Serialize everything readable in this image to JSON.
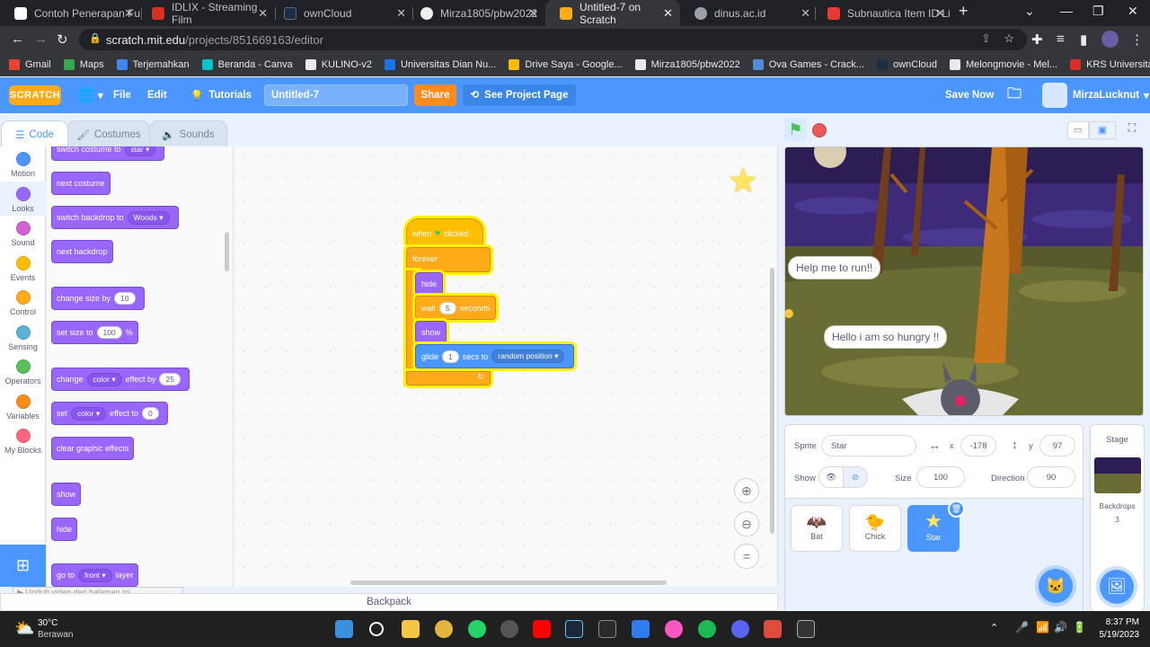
{
  "browser": {
    "tabs": [
      {
        "title": "Contoh Penerapan Fu",
        "color": "#ffffff"
      },
      {
        "title": "IDLIX - Streaming Film",
        "color": "#d93025"
      },
      {
        "title": "ownCloud",
        "color": "#1d2d44"
      },
      {
        "title": "Mirza1805/pbw2022",
        "color": "#f0f0f0"
      },
      {
        "title": "Untitled-7 on Scratch",
        "color": "#ffab19"
      },
      {
        "title": "dinus.ac.id",
        "color": "#9aa0a6"
      },
      {
        "title": "Subnautica Item ID Li",
        "color": "#e53935"
      }
    ],
    "url_host": "scratch.mit.edu",
    "url_path": "/projects/851669163/editor",
    "bookmarks": [
      {
        "label": "Gmail",
        "color": "#ea4335"
      },
      {
        "label": "Maps",
        "color": "#34a853"
      },
      {
        "label": "Terjemahkan",
        "color": "#4285f4"
      },
      {
        "label": "Beranda - Canva",
        "color": "#00c4cc"
      },
      {
        "label": "KULINO-v2",
        "color": "#e8eaed"
      },
      {
        "label": "Universitas Dian Nu...",
        "color": "#1a73e8"
      },
      {
        "label": "Drive Saya - Google...",
        "color": "#fbbc04"
      },
      {
        "label": "Mirza1805/pbw2022",
        "color": "#e8eaed"
      },
      {
        "label": "Ova Games - Crack...",
        "color": "#4f8bd6"
      },
      {
        "label": "ownCloud",
        "color": "#1d2d44"
      },
      {
        "label": "Melongmovie - Mel...",
        "color": "#e8eaed"
      },
      {
        "label": "KRS Universitas Dia...",
        "color": "#d93025"
      }
    ]
  },
  "menubar": {
    "logo": "SCRATCH",
    "file": "File",
    "edit": "Edit",
    "tutorials": "Tutorials",
    "project_title": "Untitled-7",
    "share": "Share",
    "see_project": "See Project Page",
    "save_now": "Save Now",
    "username": "MirzaLucknut"
  },
  "editor_tabs": {
    "code": "Code",
    "costumes": "Costumes",
    "sounds": "Sounds"
  },
  "categories": [
    {
      "label": "Motion",
      "color": "#4c97ff"
    },
    {
      "label": "Looks",
      "color": "#9966ff"
    },
    {
      "label": "Sound",
      "color": "#cf63cf"
    },
    {
      "label": "Events",
      "color": "#ffbf00"
    },
    {
      "label": "Control",
      "color": "#ffab19"
    },
    {
      "label": "Sensing",
      "color": "#5cb1d6"
    },
    {
      "label": "Operators",
      "color": "#59c059"
    },
    {
      "label": "Variables",
      "color": "#ff8c1a"
    },
    {
      "label": "My Blocks",
      "color": "#ff6680"
    }
  ],
  "palette": {
    "switch_costume": "switch costume to",
    "switch_costume_val": "star",
    "next_costume": "next costume",
    "switch_backdrop": "switch backdrop to",
    "switch_backdrop_val": "Woods",
    "next_backdrop": "next backdrop",
    "change_size": "change size by",
    "change_size_val": "10",
    "set_size": "set size to",
    "set_size_val": "100",
    "set_size_unit": "%",
    "change_effect": "change",
    "change_effect_dd": "color",
    "change_effect_by": "effect by",
    "change_effect_val": "25",
    "set_effect": "set",
    "set_effect_dd": "color",
    "set_effect_to": "effect to",
    "set_effect_val": "0",
    "clear_effects": "clear graphic effects",
    "show": "show",
    "hide": "hide",
    "go_to": "go to",
    "go_to_dd": "front",
    "go_to_layer": "layer"
  },
  "script": {
    "when": "when",
    "clicked": "clicked",
    "forever": "forever",
    "hide": "hide",
    "wait": "wait",
    "wait_val": "5",
    "seconds": "seconds",
    "show": "show",
    "glide": "glide",
    "glide_val": "1",
    "secs_to": "secs to",
    "glide_dd": "random position"
  },
  "backpack": "Backpack",
  "video_hint": "Unduh video dari halaman ini",
  "stage": {
    "bubble1": "Help me to run!!",
    "bubble2": "Hello i am so hungry !!"
  },
  "sprite_info": {
    "sprite_label": "Sprite",
    "sprite_name": "Star",
    "x_label": "x",
    "x": "-178",
    "y_label": "y",
    "y": "97",
    "show_label": "Show",
    "size_label": "Size",
    "size": "100",
    "direction_label": "Direction",
    "direction": "90"
  },
  "sprites": [
    {
      "name": "Bat"
    },
    {
      "name": "Chick"
    },
    {
      "name": "Star"
    }
  ],
  "stage_panel": {
    "title": "Stage",
    "backdrops_label": "Backdrops",
    "backdrops_count": "3"
  },
  "taskbar": {
    "temp": "30°C",
    "weather": "Berawan",
    "time": "8:37 PM",
    "date": "5/19/2023"
  }
}
